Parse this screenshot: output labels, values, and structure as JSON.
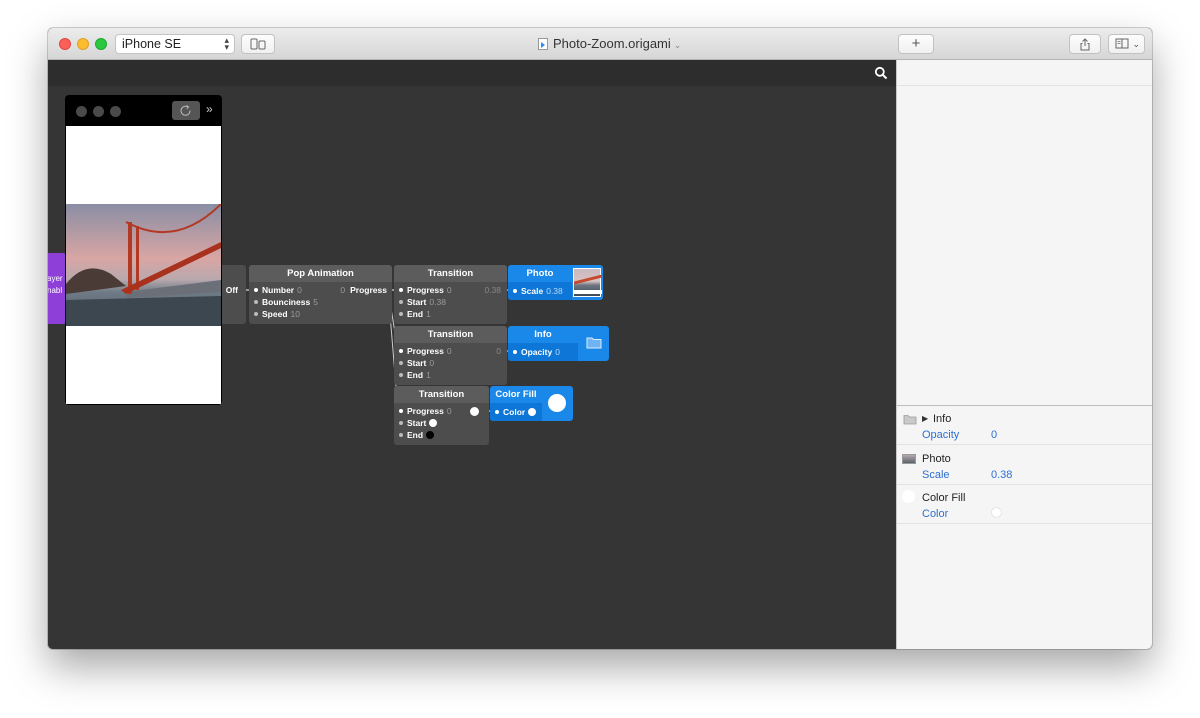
{
  "toolbar": {
    "device": "iPhone SE",
    "document_title": "Photo-Zoom.origami",
    "add_label": "+"
  },
  "colors": {
    "patch": "#4d4d4d",
    "layer_patch": "#1a88e8",
    "interaction_patch": "#8e3fd8",
    "canvas": "#353535",
    "inspector_value": "#2f6fd3"
  },
  "canvas": {
    "interaction_patch": {
      "line1": "ayer",
      "line2": "nabl"
    },
    "partial_patch": {
      "output": "Off"
    },
    "pop_animation": {
      "title": "Pop Animation",
      "inputs": [
        {
          "label": "Number",
          "value": "0"
        },
        {
          "label": "Bounciness",
          "value": "5"
        },
        {
          "label": "Speed",
          "value": "10"
        }
      ],
      "output_value": "0",
      "output_label": "Progress"
    },
    "transition_1": {
      "title": "Transition",
      "inputs": [
        {
          "label": "Progress",
          "value": "0"
        },
        {
          "label": "Start",
          "value": "0.38"
        },
        {
          "label": "End",
          "value": "1"
        }
      ],
      "output_value": "0.38"
    },
    "transition_2": {
      "title": "Transition",
      "inputs": [
        {
          "label": "Progress",
          "value": "0"
        },
        {
          "label": "Start",
          "value": "0"
        },
        {
          "label": "End",
          "value": "1"
        }
      ],
      "output_value": "0"
    },
    "transition_3": {
      "title": "Transition",
      "inputs": [
        {
          "label": "Progress",
          "value": "0"
        },
        {
          "label": "Start",
          "value": ""
        },
        {
          "label": "End",
          "value": ""
        }
      ]
    },
    "photo_layer": {
      "title": "Photo",
      "port": "Scale",
      "value": "0.38"
    },
    "info_layer": {
      "title": "Info",
      "port": "Opacity",
      "value": "0"
    },
    "colorfill_layer": {
      "title": "Color Fill",
      "port": "Color"
    }
  },
  "inspector": {
    "groups": [
      {
        "name": "Info",
        "prop": "Opacity",
        "value": "0",
        "icon": "folder-icon"
      },
      {
        "name": "Photo",
        "prop": "Scale",
        "value": "0.38",
        "icon": "photo-thumbnail"
      },
      {
        "name": "Color Fill",
        "prop": "Color",
        "value": "",
        "icon": "color-swatch-icon"
      }
    ]
  }
}
